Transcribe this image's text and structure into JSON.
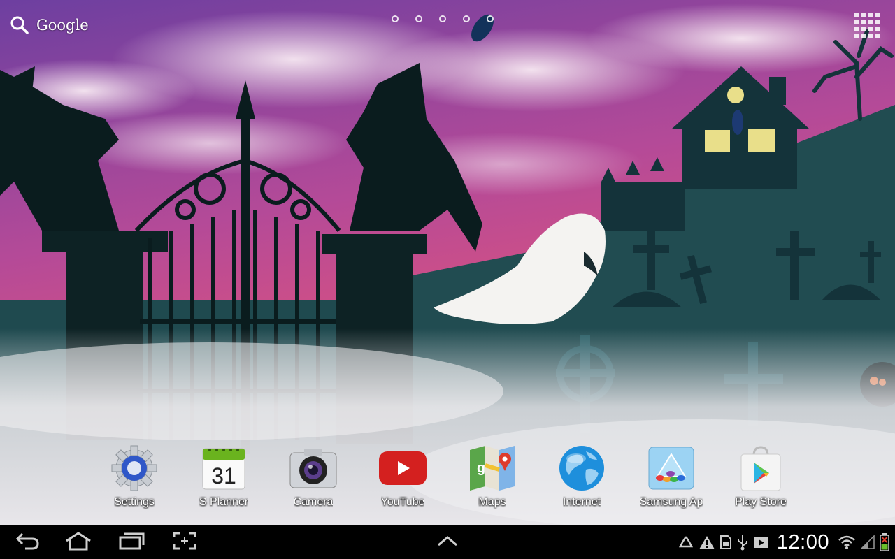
{
  "search": {
    "label": "Google",
    "icon": "search-icon"
  },
  "home_pages": {
    "count": 5
  },
  "dock": {
    "apps": [
      {
        "id": "settings",
        "label": "Settings",
        "icon": "settings-gear-icon"
      },
      {
        "id": "s-planner",
        "label": "S Planner",
        "icon": "calendar-icon",
        "icon_text": "31"
      },
      {
        "id": "camera",
        "label": "Camera",
        "icon": "camera-icon"
      },
      {
        "id": "youtube",
        "label": "YouTube",
        "icon": "youtube-icon"
      },
      {
        "id": "maps",
        "label": "Maps",
        "icon": "maps-icon"
      },
      {
        "id": "internet",
        "label": "Internet",
        "icon": "globe-icon"
      },
      {
        "id": "samsung-apps",
        "label": "Samsung Ap",
        "icon": "samsung-apps-icon"
      },
      {
        "id": "play-store",
        "label": "Play Store",
        "icon": "play-store-icon"
      }
    ]
  },
  "navbar": {
    "buttons": [
      "back-icon",
      "home-icon",
      "recent-apps-icon",
      "screenshot-icon",
      "expand-up-icon"
    ]
  },
  "status_bar": {
    "time": "12:00",
    "icons": [
      "recycle-icon",
      "warning-icon",
      "sd-card-icon",
      "usb-icon",
      "media-play-icon",
      "wifi-icon",
      "signal-icon",
      "battery-charging-icon"
    ]
  },
  "colors": {
    "sky_top": "#7a4aa8",
    "sky_bottom": "#e0507e",
    "ground": "#1f4a4f",
    "fog": "#e6e6ea",
    "navbar": "#000000"
  }
}
